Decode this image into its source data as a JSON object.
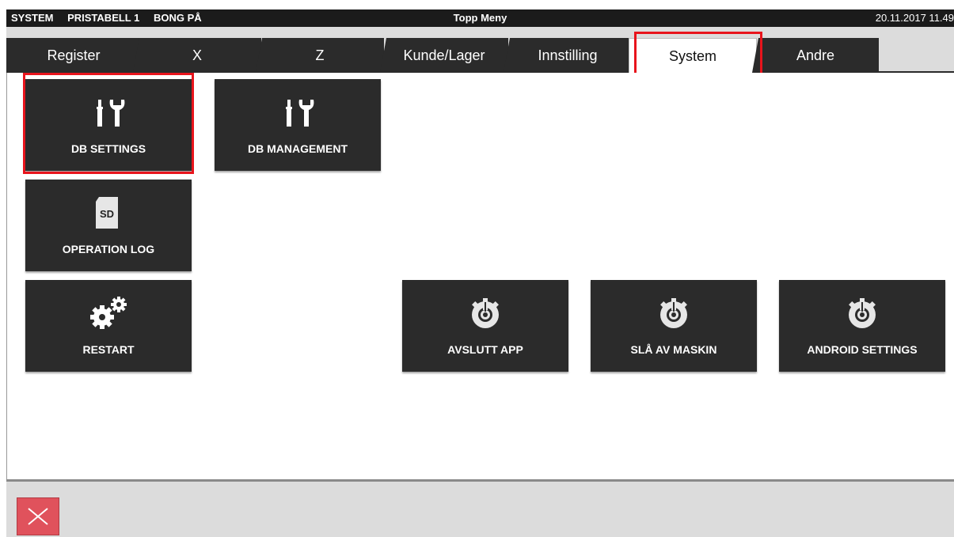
{
  "statusbar": {
    "system": "SYSTEM",
    "pricetable": "PRISTABELL 1",
    "bong": "BONG PÅ",
    "title": "Topp Meny",
    "datetime": "20.11.2017 11.49"
  },
  "tabs": [
    {
      "label": "Register"
    },
    {
      "label": "X"
    },
    {
      "label": "Z"
    },
    {
      "label": "Kunde/Lager"
    },
    {
      "label": "Innstilling"
    },
    {
      "label": "System",
      "active": true
    },
    {
      "label": "Andre"
    }
  ],
  "buttons": {
    "db_settings": {
      "label": "DB SETTINGS",
      "icon": "tools-icon"
    },
    "db_management": {
      "label": "DB MANAGEMENT",
      "icon": "tools-icon"
    },
    "operation_log": {
      "label": "OPERATION LOG",
      "icon": "sd-card-icon",
      "icon_text": "SD"
    },
    "restart": {
      "label": "RESTART",
      "icon": "gears-icon"
    },
    "avslutt_app": {
      "label": "AVSLUTT APP",
      "icon": "power-gear-icon"
    },
    "sla_av_maskin": {
      "label": "SLÅ AV MASKIN",
      "icon": "power-gear-icon"
    },
    "android_settings": {
      "label": "ANDROID SETTINGS",
      "icon": "power-gear-icon"
    }
  },
  "colors": {
    "highlight": "#e8141c",
    "button_bg": "#2b2b2b",
    "close_bg": "#e0525c"
  }
}
